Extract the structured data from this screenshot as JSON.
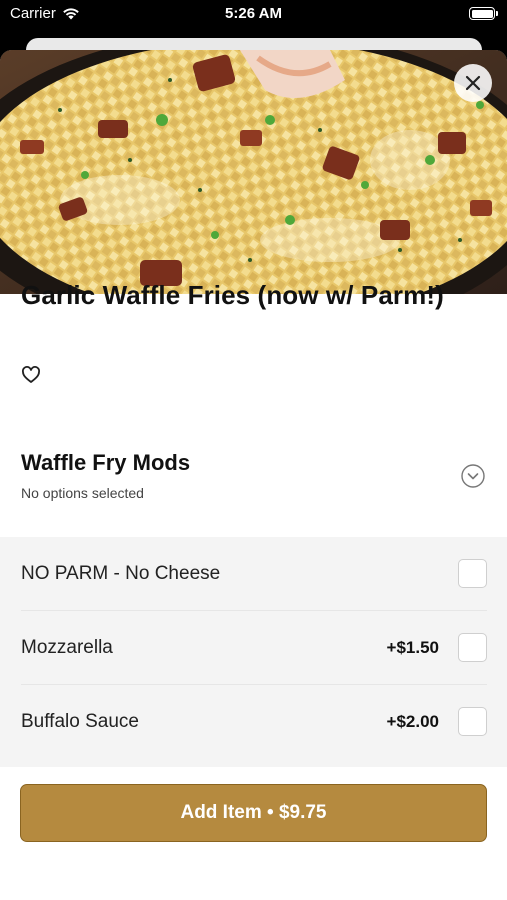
{
  "status_bar": {
    "carrier": "Carrier",
    "time": "5:26 AM"
  },
  "hero": {
    "image_description_icon": "food-photo"
  },
  "item": {
    "title": "Garlic Waffle Fries (now w/ Parm!)"
  },
  "modifier_group": {
    "title": "Waffle Fry Mods",
    "subtitle": "No options selected",
    "options": [
      {
        "label": "NO PARM - No Cheese",
        "price": "",
        "checked": false
      },
      {
        "label": "Mozzarella",
        "price": "+$1.50",
        "checked": false
      },
      {
        "label": "Buffalo Sauce",
        "price": "+$2.00",
        "checked": false
      }
    ]
  },
  "footer": {
    "add_label": "Add Item • $9.75"
  },
  "colors": {
    "accent": "#b58a3f",
    "accent_border": "#8a6420",
    "options_bg": "#f4f4f4"
  }
}
